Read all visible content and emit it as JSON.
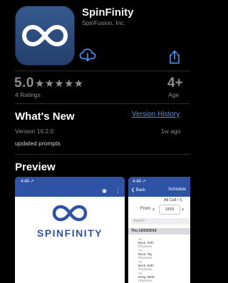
{
  "app": {
    "title": "SpinFinity",
    "developer": "SpinFusion, Inc."
  },
  "actions": {
    "download_icon": "cloud-download-icon",
    "share_icon": "share-icon"
  },
  "ratings": {
    "score": "5.0",
    "stars": "★★★★★",
    "count_label": "4 Ratings",
    "age": "4+",
    "age_label": "Age"
  },
  "whats_new": {
    "title": "What's New",
    "history_link": "Version History",
    "version": "Version 16.2.0",
    "ago": "1w ago",
    "notes": "updated prompts"
  },
  "preview": {
    "title": "Preview",
    "shot1": {
      "time": "4:49 ↗",
      "brand": "SPINFINITY"
    },
    "shot2": {
      "time": "4:49 ↗",
      "back": "❮ Back",
      "schedule": "Schedule",
      "filter": "All Call • S",
      "from_label": "From",
      "date": "10/03",
      "search_placeholder": "Search",
      "day": "Thu 10/03/2019",
      "rows": [
        {
          "a": "7a",
          "name": "Bock, Seth",
          "role": "Physician"
        },
        {
          "a": "7a",
          "name": "Bock, Tay",
          "role": "Physician"
        },
        {
          "a": "7a",
          "name": "Bock, Seth",
          "role": "Physician"
        },
        {
          "a": "7a",
          "name": "Ering, Belle",
          "role": "Physician"
        }
      ]
    }
  },
  "colors": {
    "background": "#000000",
    "link": "#5a8fd6",
    "brand_blue": "#2e52a4",
    "muted": "#8e8e93"
  }
}
